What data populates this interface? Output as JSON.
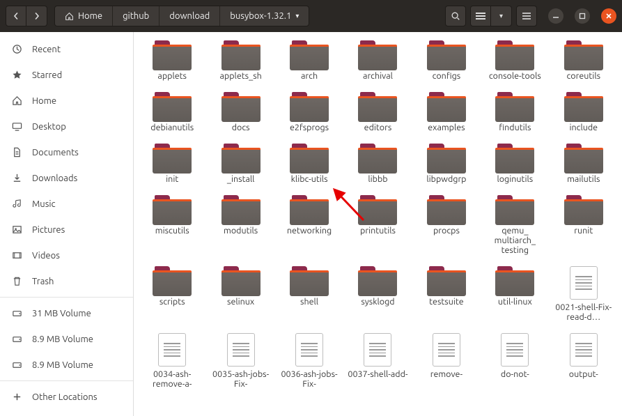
{
  "breadcrumb": [
    "Home",
    "github",
    "download",
    "busybox-1.32.1"
  ],
  "sidebar": {
    "places": [
      {
        "icon": "clock",
        "label": "Recent"
      },
      {
        "icon": "star",
        "label": "Starred"
      },
      {
        "icon": "home",
        "label": "Home"
      },
      {
        "icon": "desktop",
        "label": "Desktop"
      },
      {
        "icon": "doc",
        "label": "Documents"
      },
      {
        "icon": "download",
        "label": "Downloads"
      },
      {
        "icon": "music",
        "label": "Music"
      },
      {
        "icon": "pictures",
        "label": "Pictures"
      },
      {
        "icon": "video",
        "label": "Videos"
      },
      {
        "icon": "trash",
        "label": "Trash"
      }
    ],
    "devices": [
      {
        "icon": "disk",
        "label": "31 MB Volume"
      },
      {
        "icon": "disk",
        "label": "8.9 MB Volume"
      },
      {
        "icon": "disk",
        "label": "8.9 MB Volume"
      }
    ],
    "other": {
      "icon": "plus",
      "label": "Other Locations"
    }
  },
  "items": [
    {
      "type": "folder",
      "name": "applets"
    },
    {
      "type": "folder",
      "name": "applets_sh"
    },
    {
      "type": "folder",
      "name": "arch"
    },
    {
      "type": "folder",
      "name": "archival"
    },
    {
      "type": "folder",
      "name": "configs"
    },
    {
      "type": "folder",
      "name": "console-tools"
    },
    {
      "type": "folder",
      "name": "coreutils"
    },
    {
      "type": "folder",
      "name": "debianutils"
    },
    {
      "type": "folder",
      "name": "docs"
    },
    {
      "type": "folder",
      "name": "e2fsprogs"
    },
    {
      "type": "folder",
      "name": "editors"
    },
    {
      "type": "folder",
      "name": "examples"
    },
    {
      "type": "folder",
      "name": "findutils"
    },
    {
      "type": "folder",
      "name": "include"
    },
    {
      "type": "folder",
      "name": "init"
    },
    {
      "type": "folder",
      "name": "_install"
    },
    {
      "type": "folder",
      "name": "klibc-utils"
    },
    {
      "type": "folder",
      "name": "libbb"
    },
    {
      "type": "folder",
      "name": "libpwdgrp"
    },
    {
      "type": "folder",
      "name": "loginutils"
    },
    {
      "type": "folder",
      "name": "mailutils"
    },
    {
      "type": "folder",
      "name": "miscutils"
    },
    {
      "type": "folder",
      "name": "modutils"
    },
    {
      "type": "folder",
      "name": "networking"
    },
    {
      "type": "folder",
      "name": "printutils"
    },
    {
      "type": "folder",
      "name": "procps"
    },
    {
      "type": "folder",
      "name": "qemu_\nmultiarch_\ntesting"
    },
    {
      "type": "folder",
      "name": "runit"
    },
    {
      "type": "folder",
      "name": "scripts"
    },
    {
      "type": "folder",
      "name": "selinux"
    },
    {
      "type": "folder",
      "name": "shell"
    },
    {
      "type": "folder",
      "name": "sysklogd"
    },
    {
      "type": "folder",
      "name": "testsuite"
    },
    {
      "type": "folder",
      "name": "util-linux"
    },
    {
      "type": "file",
      "name": "0021-shell-Fix-read-d…"
    },
    {
      "type": "file",
      "name": "0034-ash-remove-a-"
    },
    {
      "type": "file",
      "name": "0035-ash-jobs-Fix-"
    },
    {
      "type": "file",
      "name": "0036-ash-jobs-Fix-"
    },
    {
      "type": "file",
      "name": "0037-shell-add-"
    },
    {
      "type": "file",
      "name": "remove-"
    },
    {
      "type": "file",
      "name": "do-not-"
    },
    {
      "type": "file",
      "name": "output-"
    }
  ]
}
